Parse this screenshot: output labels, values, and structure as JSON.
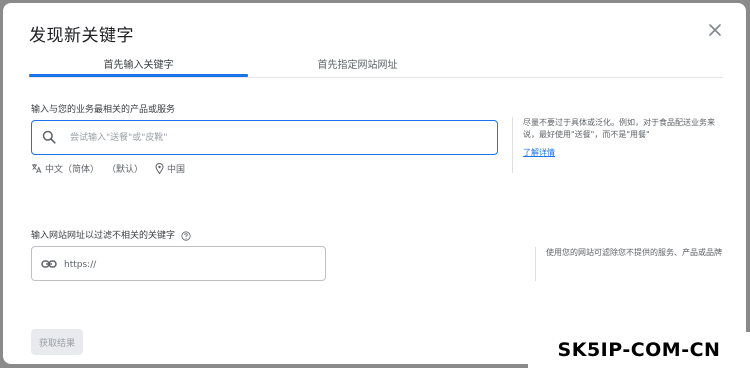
{
  "dialog": {
    "title": "发现新关键字",
    "close_icon": "close-icon"
  },
  "tabs": [
    {
      "label": "首先输入关键字",
      "active": true
    },
    {
      "label": "首先指定网站网址",
      "active": false
    }
  ],
  "keyword_section": {
    "label": "输入与您的业务最相关的产品或服务",
    "placeholder": "尝试输入\"送餐\"或\"皮靴\"",
    "value": "",
    "icon": "search-icon",
    "language": "中文（简体）",
    "language_default": "（默认）",
    "location": "中国",
    "help_text": "尽量不要过于具体或泛化。例如，对于食品配送业务来说，最好使用\"送餐\"，而不是\"用餐\"",
    "learn_more": "了解详情"
  },
  "url_section": {
    "label": "输入网站网址以过滤不相关的关键字",
    "placeholder": "https://",
    "value": "",
    "icon": "link-icon",
    "help_text": "使用您的网站可滤除您不提供的服务、产品或品牌"
  },
  "actions": {
    "submit_label": "获取结果",
    "submit_enabled": false
  },
  "watermark": {
    "text": "SK5IP-COM-CN"
  },
  "colors": {
    "accent": "#1a73e8",
    "disabled_bg": "#e8eaed",
    "disabled_text": "#9aa0a6"
  }
}
